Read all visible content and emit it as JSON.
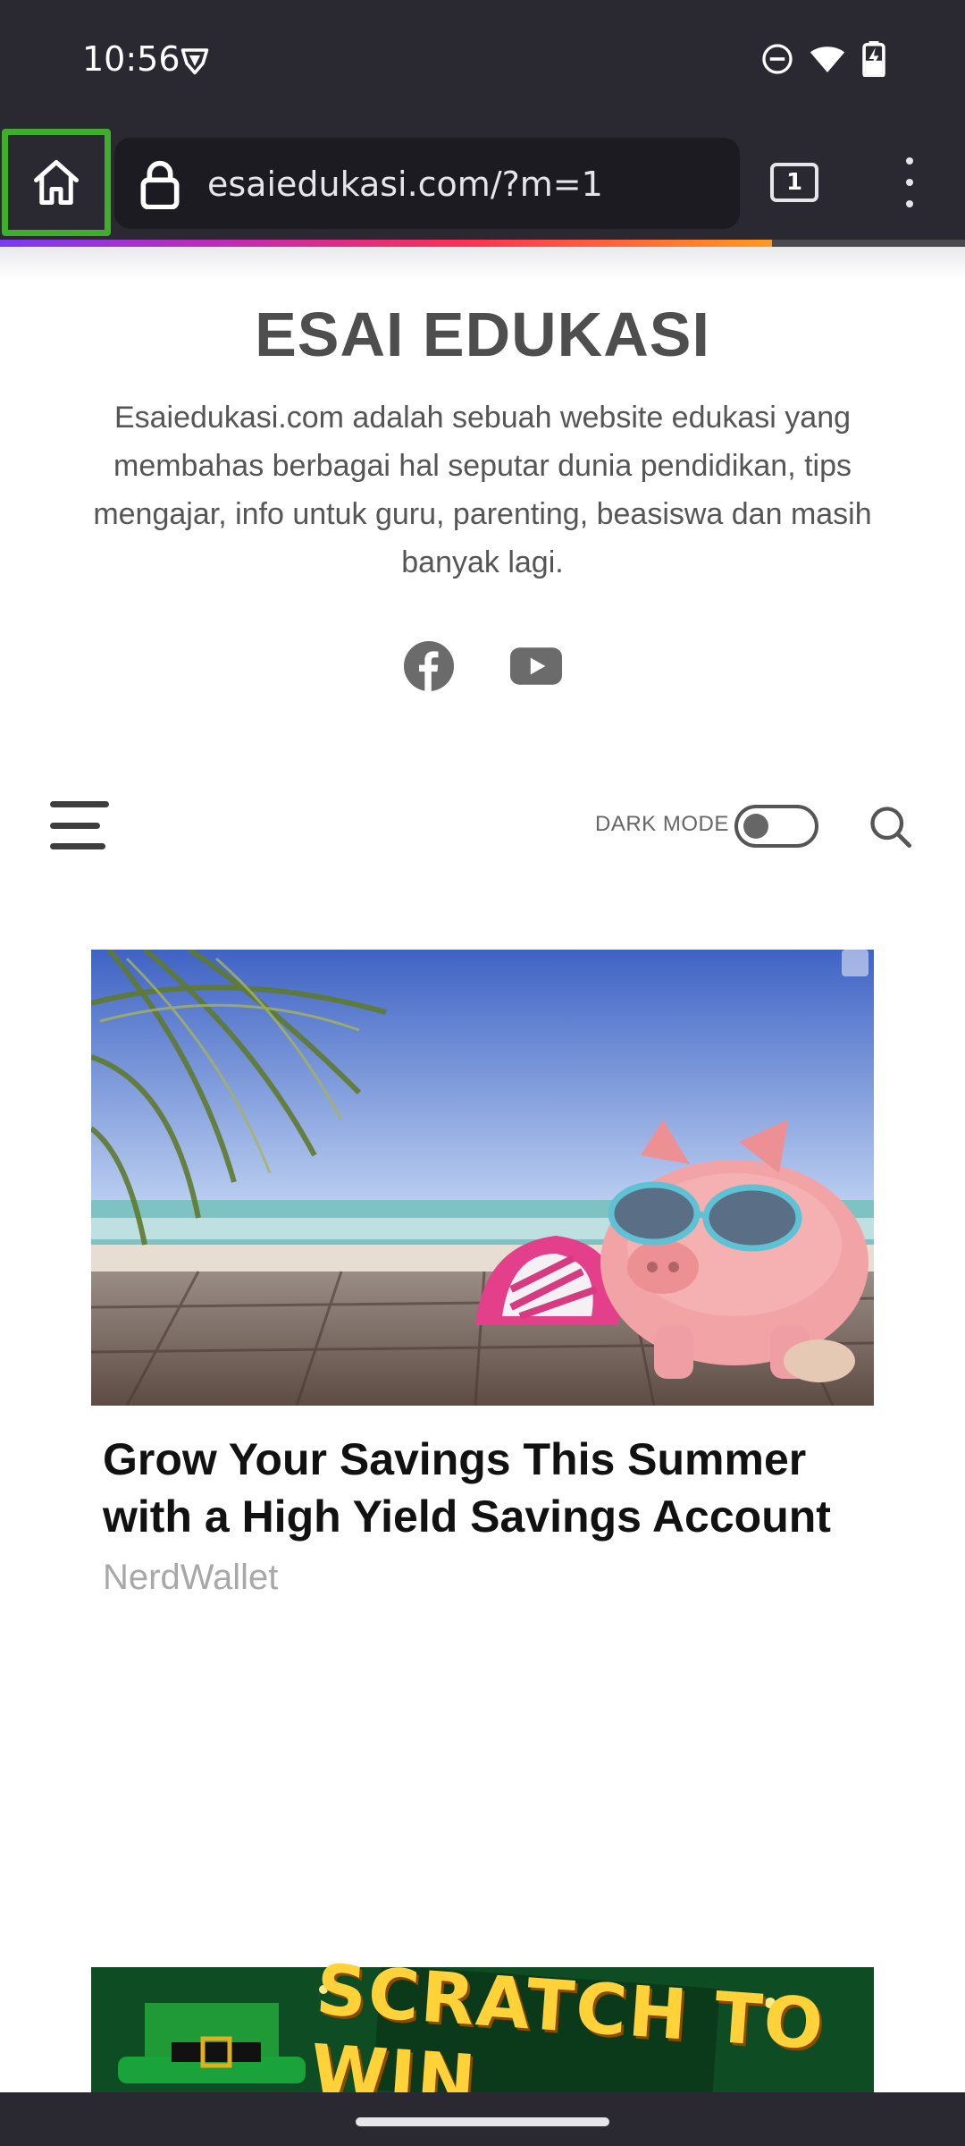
{
  "status_bar": {
    "time": "10:56",
    "icons": [
      "vpn-shield-icon",
      "do-not-disturb-icon",
      "wifi-icon",
      "battery-charging-icon"
    ]
  },
  "browser": {
    "url": "esaiedukasi.com/?m=1",
    "tab_count": "1",
    "load_progress": 0.8,
    "highlight_color": "#3fae2a"
  },
  "site": {
    "title": "ESAI EDUKASI",
    "description": "Esaiedukasi.com adalah sebuah website edukasi yang membahas berbagai hal seputar dunia pendidikan, tips mengajar, info untuk guru, parenting, beasiswa dan masih banyak lagi.",
    "social_icons": [
      "facebook-icon",
      "youtube-icon"
    ]
  },
  "nav": {
    "dark_mode_label": "DARK MODE",
    "dark_mode_on": false
  },
  "ads": [
    {
      "headline": "Grow Your Savings This Summer with a High Yield Savings Account",
      "source": "NerdWallet"
    },
    {
      "banner_text": "SCRATCH TO WIN"
    }
  ]
}
